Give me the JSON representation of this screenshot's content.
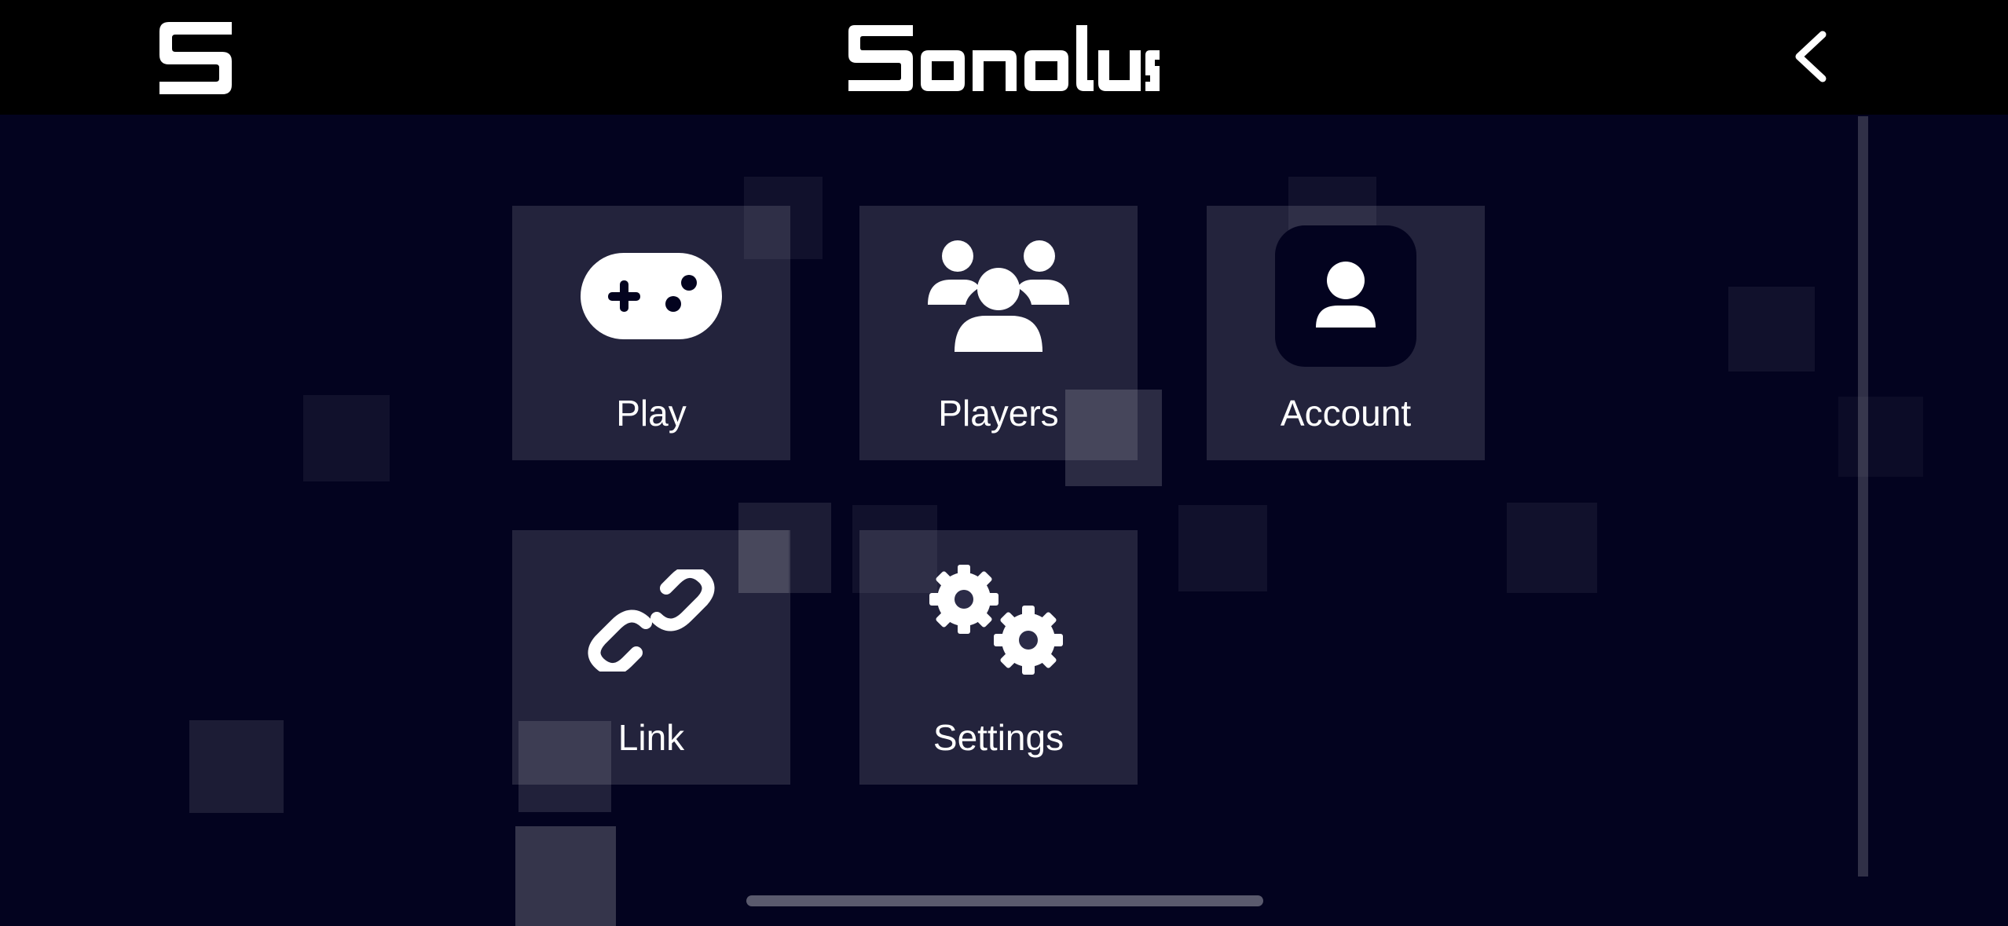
{
  "header": {
    "logo_icon": "sonolus-s-logo-icon",
    "brand_text": "Sonolus",
    "back_icon": "chevron-left-icon"
  },
  "menu": {
    "items": [
      {
        "label": "Play",
        "icon": "gamepad-icon"
      },
      {
        "label": "Players",
        "icon": "users-icon"
      },
      {
        "label": "Account",
        "icon": "user-square-icon"
      },
      {
        "label": "Link",
        "icon": "link-icon"
      },
      {
        "label": "Settings",
        "icon": "gears-icon"
      }
    ]
  },
  "colors": {
    "background": "#03031f",
    "topbar": "#000000",
    "tile": "rgba(255,255,255,0.13)",
    "text": "#ffffff"
  }
}
